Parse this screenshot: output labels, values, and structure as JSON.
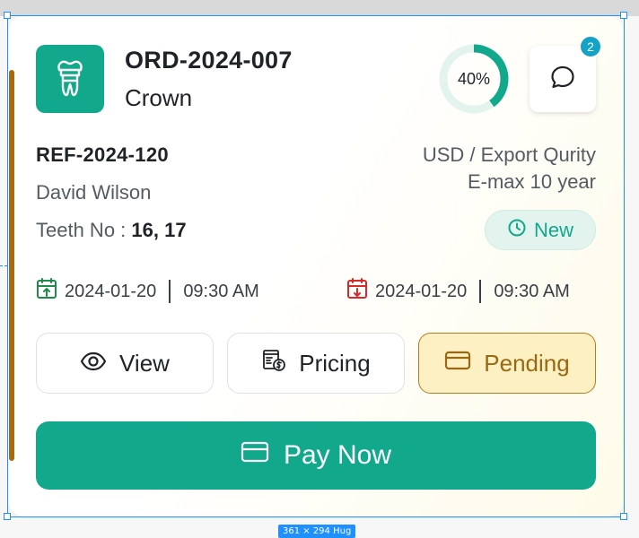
{
  "order": {
    "id": "ORD-2024-007",
    "type": "Crown",
    "progress_percent": 40,
    "progress_label": "40%",
    "unread_messages": "2",
    "reference": "REF-2024-120",
    "patient_name": "David Wilson",
    "teeth_label": "Teeth No :",
    "teeth_value": "16, 17",
    "currency_quality": "USD / Export Qurity",
    "material_warranty": "E-max 10 year",
    "status": "New"
  },
  "dates": {
    "start_date": "2024-01-20",
    "start_time": "09:30 AM",
    "end_date": "2024-01-20",
    "end_time": "09:30 AM"
  },
  "actions": {
    "view_label": "View",
    "pricing_label": "Pricing",
    "pending_label": "Pending",
    "pay_label": "Pay Now"
  },
  "canvas": {
    "size_badge": "361 × 294 Hug"
  },
  "colors": {
    "brand_teal": "#12a88c",
    "accent_bar": "#a86a10",
    "pending_bg": "#fdf1c4",
    "pending_border": "#b57d1b",
    "badge_blue": "#13a3c6",
    "start_date_icon": "#1f8a4c",
    "end_date_icon": "#d42a2a"
  },
  "icons": {
    "tooth": "tooth-crown-icon",
    "chat": "chat-bubble-icon",
    "clock": "clock-icon",
    "calendar_start": "calendar-arrow-up-icon",
    "calendar_end": "calendar-arrow-down-icon",
    "eye": "eye-icon",
    "invoice": "invoice-icon",
    "card": "credit-card-icon"
  }
}
